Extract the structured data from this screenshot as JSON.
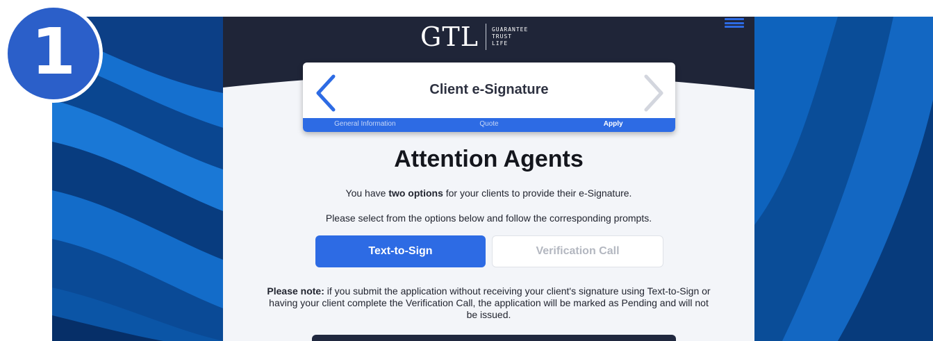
{
  "step_badge": {
    "number": "1"
  },
  "logo": {
    "mark": "GTL",
    "words": [
      "GUARANTEE",
      "TRUST",
      "LIFE"
    ]
  },
  "nav": {
    "title": "Client e-Signature",
    "steps": [
      {
        "label": "General Information",
        "active": false
      },
      {
        "label": "Quote",
        "active": false
      },
      {
        "label": "Apply",
        "active": true
      }
    ]
  },
  "content": {
    "heading": "Attention Agents",
    "line1_prefix": "You have ",
    "line1_bold": "two options",
    "line1_suffix": " for your clients to provide their e-Signature.",
    "line2": "Please select from the options below and follow the corresponding prompts."
  },
  "buttons": {
    "text_to_sign": "Text-to-Sign",
    "verification_call": "Verification Call"
  },
  "note": {
    "bold": "Please note:",
    "text": " if you submit the application without receiving your client's signature using Text-to-Sign or having your client complete the Verification Call, the application will be marked as Pending and will not be issued."
  },
  "colors": {
    "accent": "#2d6be4",
    "header_dark": "#1f2538",
    "badge": "#2b5fc9",
    "wave_blue": "#0a56a8"
  },
  "icons": {
    "back": "chevron-left-icon",
    "forward": "chevron-right-icon",
    "menu": "hamburger-menu-icon"
  }
}
